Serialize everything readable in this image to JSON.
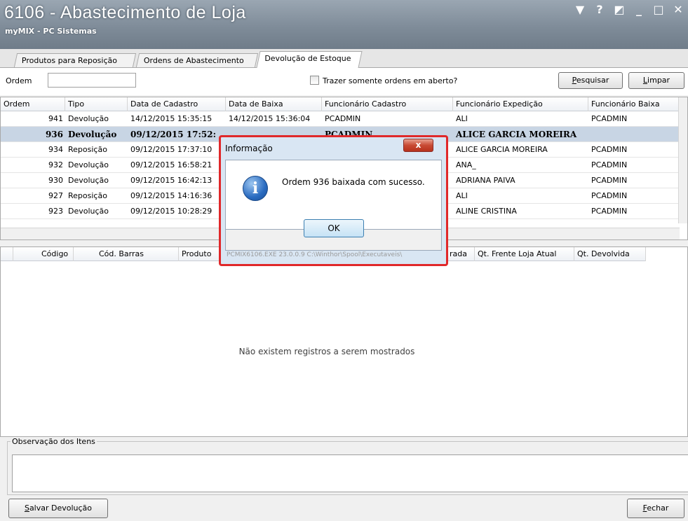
{
  "window": {
    "title": "6106 - Abastecimento de Loja",
    "subtitle": "myMIX - PC Sistemas",
    "controls": [
      "▼",
      "?",
      "◩",
      "_",
      "□",
      "✕"
    ]
  },
  "tabs": [
    {
      "label": "Produtos para Reposição"
    },
    {
      "label": "Ordens de Abastecimento"
    },
    {
      "label": "Devolução de Estoque",
      "active": true
    }
  ],
  "filter": {
    "ordem_label": "Ordem",
    "ordem_value": "",
    "checkbox_label": "Trazer somente ordens em aberto?",
    "checkbox_checked": false,
    "pesquisar_label": "Pesquisar",
    "limpar_label": "Limpar"
  },
  "grid": {
    "columns": [
      "Ordem",
      "Tipo",
      "Data de Cadastro",
      "Data de Baixa",
      "Funcionário Cadastro",
      "Funcionário Expedição",
      "Funcionário Baixa"
    ],
    "rows": [
      {
        "ordem": "941",
        "tipo": "Devolução",
        "cadastro": "14/12/2015 15:35:15",
        "baixa": "14/12/2015 15:36:04",
        "func_cad": "PCADMIN",
        "func_exp": "ALI",
        "func_baixa": "PCADMIN"
      },
      {
        "ordem": "936",
        "tipo": "Devolução",
        "cadastro": "09/12/2015 17:52:",
        "baixa": "",
        "func_cad": "PCADMIN",
        "func_exp": "ALICE GARCIA MOREIRA",
        "func_baixa": "",
        "selected": true
      },
      {
        "ordem": "934",
        "tipo": "Reposição",
        "cadastro": "09/12/2015 17:37:10",
        "baixa": "",
        "func_cad": "",
        "func_exp": "ALICE GARCIA MOREIRA",
        "func_baixa": "PCADMIN"
      },
      {
        "ordem": "932",
        "tipo": "Devolução",
        "cadastro": "09/12/2015 16:58:21",
        "baixa": "",
        "func_cad": "",
        "func_exp": "ANA_",
        "func_baixa": "PCADMIN"
      },
      {
        "ordem": "930",
        "tipo": "Devolução",
        "cadastro": "09/12/2015 16:42:13",
        "baixa": "",
        "func_cad": "",
        "func_exp": "ADRIANA PAIVA",
        "func_baixa": "PCADMIN"
      },
      {
        "ordem": "927",
        "tipo": "Reposição",
        "cadastro": "09/12/2015 14:16:36",
        "baixa": "",
        "func_cad": "",
        "func_exp": "ALI",
        "func_baixa": "PCADMIN"
      },
      {
        "ordem": "923",
        "tipo": "Devolução",
        "cadastro": "09/12/2015 10:28:29",
        "baixa": "",
        "func_cad": "",
        "func_exp": "ALINE CRISTINA",
        "func_baixa": "PCADMIN"
      }
    ]
  },
  "items_grid": {
    "columns": [
      "Código",
      "Cód. Barras",
      "Produto",
      "rada",
      "Qt. Frente Loja Atual",
      "Qt. Devolvida"
    ],
    "empty_message": "Não existem registros a serem mostrados"
  },
  "observacao": {
    "legend": "Observação dos Itens",
    "value": ""
  },
  "footer": {
    "salvar_label": "Salvar Devolução",
    "fechar_label": "Fechar"
  },
  "dialog": {
    "title": "Informação",
    "close_glyph": "x",
    "message": "Ordem 936 baixada com sucesso.",
    "ok_label": "OK",
    "status": "PCMIX6106.EXE 23.0.0.9 C:\\Winthor\\Spool\\Executaveis\\",
    "icon": "info-icon"
  }
}
